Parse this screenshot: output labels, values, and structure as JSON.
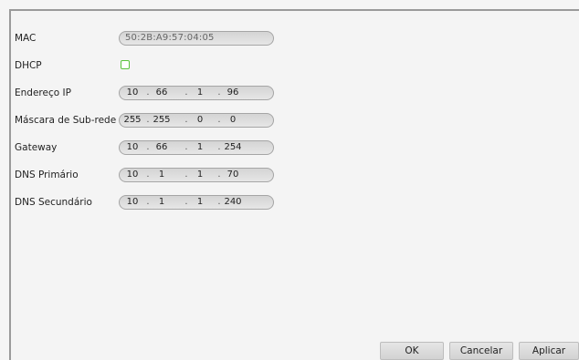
{
  "form": {
    "mac": {
      "label": "MAC",
      "value": "50:2B:A9:57:04:05"
    },
    "dhcp": {
      "label": "DHCP",
      "checked": false
    },
    "ip": {
      "label": "Endereço IP",
      "octets": [
        "10",
        "66",
        "1",
        "96"
      ]
    },
    "subnet": {
      "label": "Máscara de Sub-rede",
      "octets": [
        "255",
        "255",
        "0",
        "0"
      ]
    },
    "gateway": {
      "label": "Gateway",
      "octets": [
        "10",
        "66",
        "1",
        "254"
      ]
    },
    "dns1": {
      "label": "DNS Primário",
      "octets": [
        "10",
        "1",
        "1",
        "70"
      ]
    },
    "dns2": {
      "label": "DNS Secundário",
      "octets": [
        "10",
        "1",
        "1",
        "240"
      ]
    },
    "dot": "."
  },
  "buttons": {
    "ok": "OK",
    "cancel": "Cancelar",
    "apply": "Aplicar"
  },
  "colors": {
    "checkbox_border": "#59c23b"
  }
}
